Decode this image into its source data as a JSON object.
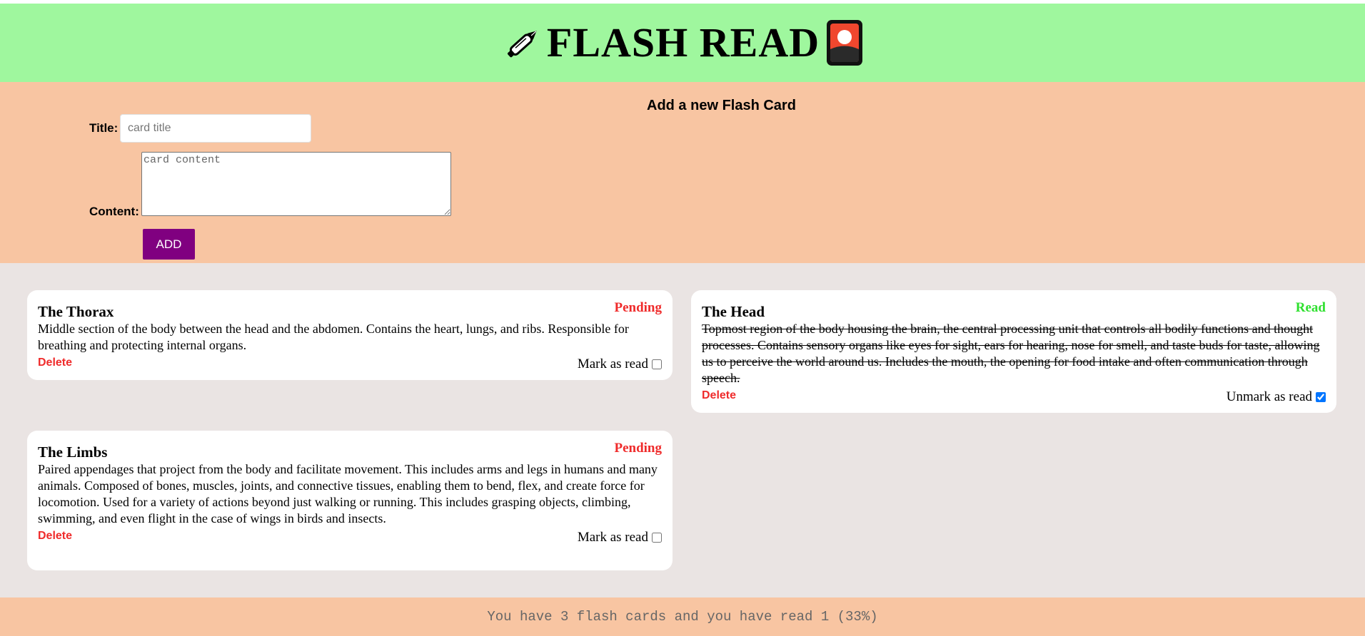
{
  "header": {
    "title": "FLASH READ",
    "left_icon": "fountain-pen-icon",
    "right_icon": "card-icon",
    "background": "#9ff79e"
  },
  "form": {
    "heading": "Add a new Flash Card",
    "title_label": "Title:",
    "title_placeholder": "card title",
    "title_value": "",
    "content_label": "Content:",
    "content_placeholder": "card content",
    "content_value": "",
    "add_label": "ADD",
    "add_color": "#800080",
    "background": "#f8c5a2"
  },
  "cards": [
    {
      "title": "The Thorax",
      "status": "Pending",
      "content": "Middle section of the body between the head and the abdomen. Contains the heart, lungs, and ribs. Responsible for breathing and protecting internal organs.",
      "delete_label": "Delete",
      "toggle_label": "Mark as read",
      "read": false
    },
    {
      "title": "The Head",
      "status": "Read",
      "content": "Topmost region of the body housing the brain, the central processing unit that controls all bodily functions and thought processes. Contains sensory organs like eyes for sight, ears for hearing, nose for smell, and taste buds for taste, allowing us to perceive the world around us. Includes the mouth, the opening for food intake and often communication through speech.",
      "delete_label": "Delete",
      "toggle_label": "Unmark as read",
      "read": true
    },
    {
      "title": "The Limbs",
      "status": "Pending",
      "content": "Paired appendages that project from the body and facilitate movement. This includes arms and legs in humans and many animals. Composed of bones, muscles, joints, and connective tissues, enabling them to bend, flex, and create force for locomotion. Used for a variety of actions beyond just walking or running. This includes grasping objects, climbing, swimming, and even flight in the case of wings in birds and insects.",
      "delete_label": "Delete",
      "toggle_label": "Mark as read",
      "read": false
    }
  ],
  "colors": {
    "pending": "#ef2b2b",
    "read": "#2fe02f",
    "cards_background": "#eae4e3"
  },
  "footer": {
    "text": "You have 3 flash cards and you have read 1 (33%)"
  }
}
